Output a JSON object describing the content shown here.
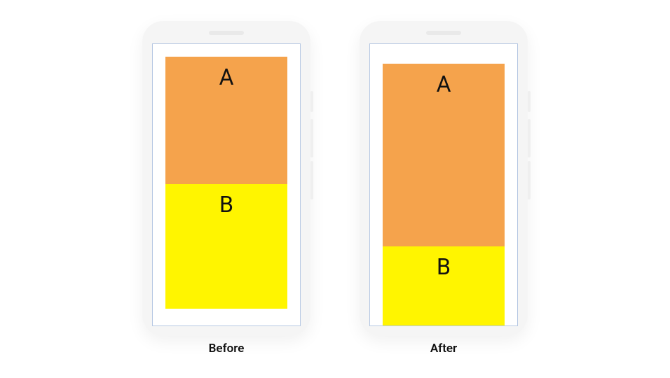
{
  "colors": {
    "blockA": "#f5a34c",
    "blockB": "#fff500",
    "phoneBody": "#f5f5f5",
    "screenBorder": "#b6c8e3"
  },
  "before": {
    "caption": "Before",
    "blockA_label": "A",
    "blockB_label": "B"
  },
  "after": {
    "caption": "After",
    "blockA_label": "A",
    "blockB_label": "B"
  }
}
